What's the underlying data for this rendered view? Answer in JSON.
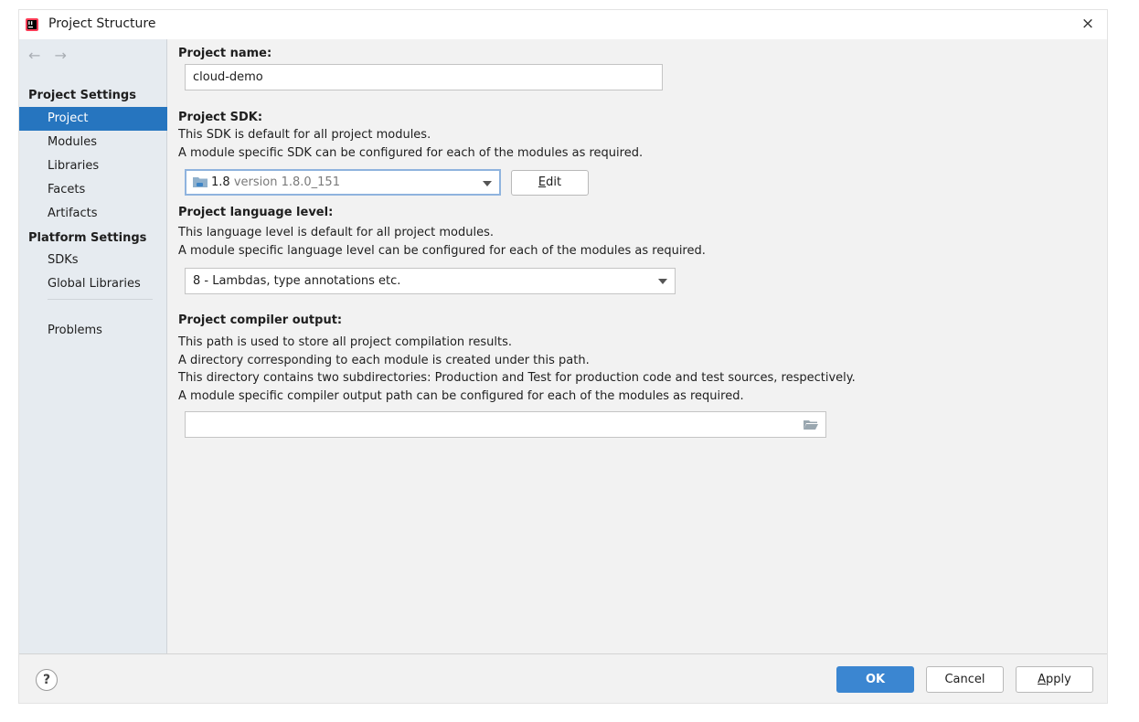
{
  "window": {
    "title": "Project Structure",
    "app_icon": "intellij-idea-icon",
    "close_symbol": "×"
  },
  "sidebar": {
    "back_arrow": "←",
    "forward_arrow": "→",
    "groups": [
      {
        "title": "Project Settings"
      },
      {
        "title": "Platform Settings"
      }
    ],
    "items": [
      {
        "label": "Project",
        "selected": true
      },
      {
        "label": "Modules"
      },
      {
        "label": "Libraries"
      },
      {
        "label": "Facets"
      },
      {
        "label": "Artifacts"
      },
      {
        "label": "SDKs"
      },
      {
        "label": "Global Libraries"
      },
      {
        "label": "Problems"
      }
    ]
  },
  "project_name": {
    "label": "Project name:",
    "value": "cloud-demo"
  },
  "project_sdk": {
    "label": "Project SDK:",
    "desc_lines": [
      "This SDK is default for all project modules.",
      "A module specific SDK can be configured for each of the modules as required."
    ],
    "selected_name": "1.8",
    "selected_version": "version 1.8.0_151",
    "edit_button_mnemonic": "E",
    "edit_button_rest": "dit"
  },
  "language_level": {
    "label": "Project language level:",
    "desc_lines": [
      "This language level is default for all project modules.",
      "A module specific language level can be configured for each of the modules as required."
    ],
    "selected": "8 - Lambdas, type annotations etc."
  },
  "compiler_output": {
    "label": "Project compiler output:",
    "desc_lines": [
      "This path is used to store all project compilation results.",
      "A directory corresponding to each module is created under this path.",
      "This directory contains two subdirectories: Production and Test for production code and test sources, respectively.",
      "A module specific compiler output path can be configured for each of the modules as required."
    ],
    "value": ""
  },
  "footer": {
    "help_symbol": "?",
    "ok_label": "OK",
    "cancel_label": "Cancel",
    "apply_mnemonic": "A",
    "apply_rest": "pply"
  },
  "colors": {
    "selection": "#2675bf",
    "primary_button": "#3b86d1",
    "sidebar_bg": "#e6ebf0",
    "content_bg": "#f2f2f2"
  }
}
